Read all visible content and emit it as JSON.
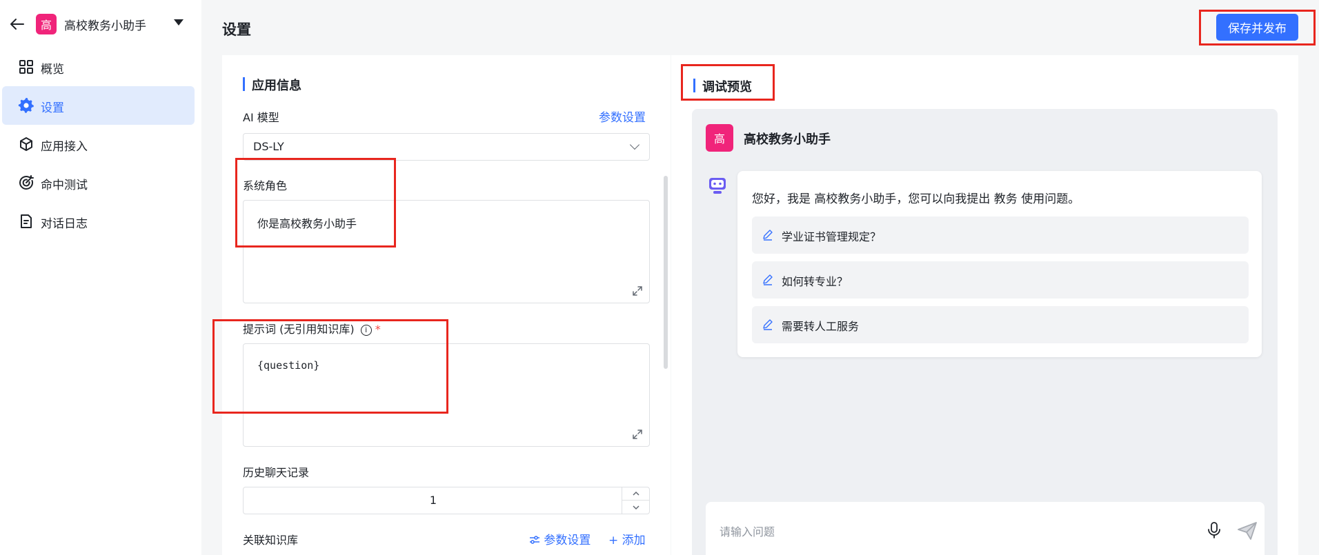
{
  "sidebar": {
    "app_avatar": "高",
    "app_name": "高校教务小助手",
    "items": [
      {
        "label": "概览",
        "icon": "grid-icon"
      },
      {
        "label": "设置",
        "icon": "gear-icon",
        "active": true
      },
      {
        "label": "应用接入",
        "icon": "cube-icon"
      },
      {
        "label": "命中测试",
        "icon": "target-icon"
      },
      {
        "label": "对话日志",
        "icon": "document-icon"
      }
    ]
  },
  "header": {
    "title": "设置",
    "publish_label": "保存并发布"
  },
  "app_info": {
    "section_title": "应用信息",
    "model_label": "AI 模型",
    "model_params_link": "参数设置",
    "model_value": "DS-LY",
    "role_label": "系统角色",
    "role_value": "你是高校教务小助手",
    "prompt_label": "提示词 (无引用知识库)",
    "prompt_required": "*",
    "prompt_value": "{question}",
    "history_label": "历史聊天记录",
    "history_value": "1",
    "kb_label": "关联知识库",
    "kb_params_link": "参数设置",
    "kb_add_link": "+ 添加"
  },
  "preview": {
    "section_title": "调试预览",
    "bot_avatar": "高",
    "bot_name": "高校教务小助手",
    "greeting": "您好，我是 高校教务小助手，您可以向我提出 教务 使用问题。",
    "suggestions": [
      {
        "label": "学业证书管理规定？"
      },
      {
        "label": "如何转专业？"
      },
      {
        "label": "需要转人工服务"
      }
    ],
    "input_placeholder": "请输入问题"
  },
  "colors": {
    "accent": "#3370ff",
    "avatar": "#f0247a",
    "annotation": "#e8261e"
  }
}
